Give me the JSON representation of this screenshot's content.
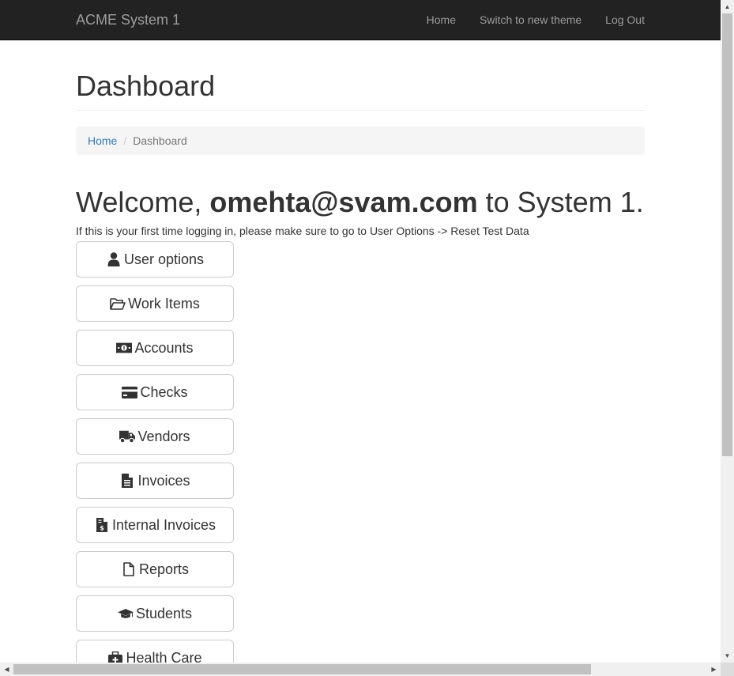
{
  "navbar": {
    "brand": "ACME System 1",
    "links": [
      "Home",
      "Switch to new theme",
      "Log Out"
    ]
  },
  "page": {
    "title": "Dashboard",
    "breadcrumb": {
      "home": "Home",
      "separator": "/",
      "current": "Dashboard"
    },
    "welcome": {
      "prefix": "Welcome, ",
      "user": "omehta@svam.com",
      "suffix": " to System 1."
    },
    "hint": "If this is your first time logging in, please make sure to go to User Options -> Reset Test Data"
  },
  "menu": [
    {
      "label": "User options",
      "icon": "user-icon"
    },
    {
      "label": "Work Items",
      "icon": "folder-open-icon"
    },
    {
      "label": "Accounts",
      "icon": "money-icon"
    },
    {
      "label": "Checks",
      "icon": "credit-card-icon"
    },
    {
      "label": "Vendors",
      "icon": "truck-icon"
    },
    {
      "label": "Invoices",
      "icon": "file-text-icon"
    },
    {
      "label": "Internal Invoices",
      "icon": "file-invoice-dollar-icon"
    },
    {
      "label": "Reports",
      "icon": "file-icon"
    },
    {
      "label": "Students",
      "icon": "graduation-cap-icon"
    },
    {
      "label": "Health Care",
      "icon": "medkit-icon"
    }
  ],
  "colors": {
    "navbar": "#222222",
    "link": "#337ab7",
    "breadcrumb_bg": "#f5f5f5",
    "button_border": "#cccccc"
  },
  "scrollbar": {
    "up": "▲",
    "down": "▼",
    "left": "◀",
    "right": "▶"
  }
}
